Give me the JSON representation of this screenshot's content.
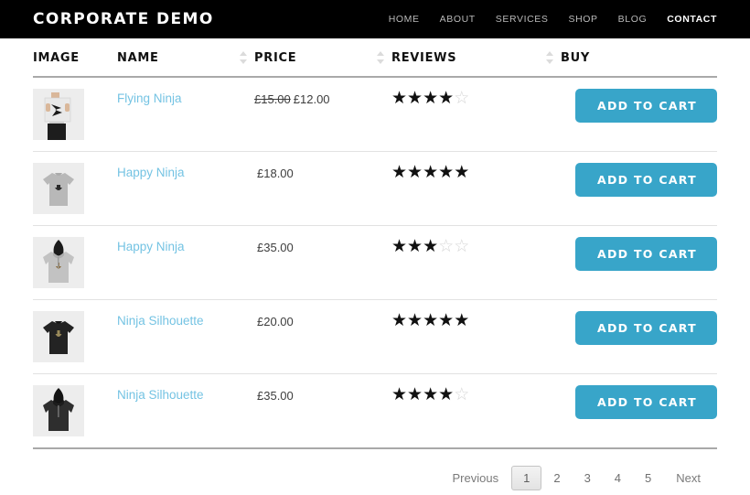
{
  "header": {
    "logo": "CORPORATE DEMO",
    "nav": [
      {
        "label": "HOME",
        "active": false
      },
      {
        "label": "ABOUT",
        "active": false
      },
      {
        "label": "SERVICES",
        "active": false
      },
      {
        "label": "SHOP",
        "active": false
      },
      {
        "label": "BLOG",
        "active": false
      },
      {
        "label": "CONTACT",
        "active": true
      }
    ]
  },
  "table": {
    "columns": [
      {
        "label": "IMAGE",
        "sortable": false
      },
      {
        "label": "NAME",
        "sortable": true
      },
      {
        "label": "PRICE",
        "sortable": true
      },
      {
        "label": "REVIEWS",
        "sortable": true
      },
      {
        "label": "BUY",
        "sortable": false
      }
    ],
    "rows": [
      {
        "image": "poster-ninja-thumbnail",
        "name": "Flying Ninja",
        "price_old": "£15.00",
        "price": "£12.00",
        "rating": 4,
        "rating_max": 5,
        "buy_label": "ADD TO CART"
      },
      {
        "image": "grey-tshirt-thumbnail",
        "name": "Happy Ninja",
        "price_old": "",
        "price": "£18.00",
        "rating": 5,
        "rating_max": 5,
        "buy_label": "ADD TO CART"
      },
      {
        "image": "grey-hoodie-thumbnail",
        "name": "Happy Ninja",
        "price_old": "",
        "price": "£35.00",
        "rating": 3,
        "rating_max": 5,
        "buy_label": "ADD TO CART"
      },
      {
        "image": "black-tshirt-thumbnail",
        "name": "Ninja Silhouette",
        "price_old": "",
        "price": "£20.00",
        "rating": 5,
        "rating_max": 5,
        "buy_label": "ADD TO CART"
      },
      {
        "image": "black-hoodie-thumbnail",
        "name": "Ninja Silhouette",
        "price_old": "",
        "price": "£35.00",
        "rating": 4,
        "rating_max": 5,
        "buy_label": "ADD TO CART"
      }
    ]
  },
  "pagination": {
    "previous_label": "Previous",
    "next_label": "Next",
    "pages": [
      "1",
      "2",
      "3",
      "4",
      "5"
    ],
    "current_page": "1"
  },
  "colors": {
    "header_bg": "#000000",
    "accent_button": "#38a5c9",
    "link_blue": "#74c3e3",
    "star_full": "#111111",
    "star_empty": "#d6d6d6"
  },
  "icons": {
    "sort": "sort-arrows-icon"
  }
}
